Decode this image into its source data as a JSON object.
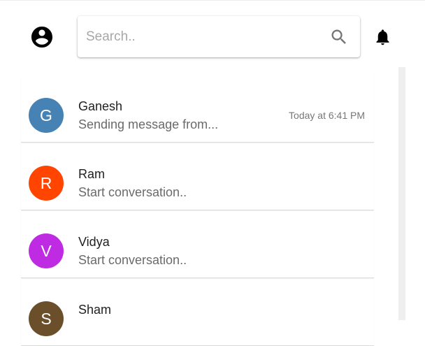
{
  "header": {
    "search_placeholder": "Search..",
    "search_value": ""
  },
  "icons": {
    "account": "account-circle-icon",
    "search": "search-icon",
    "notifications": "bell-icon"
  },
  "chats": [
    {
      "initial": "G",
      "name": "Ganesh",
      "preview": "Sending message from...",
      "time": "Today at 6:41 PM",
      "color": "#4682b4"
    },
    {
      "initial": "R",
      "name": "Ram",
      "preview": "Start conversation..",
      "time": "",
      "color": "#ff4500"
    },
    {
      "initial": "V",
      "name": "Vidya",
      "preview": "Start conversation..",
      "time": "",
      "color": "#bf2be2"
    },
    {
      "initial": "S",
      "name": "Sham",
      "preview": "",
      "time": "",
      "color": "#6b4f2a"
    }
  ],
  "colors": {
    "scroll_track": "#efefef",
    "placeholder": "#a7a7a7",
    "preview_text": "#6a6a6a"
  }
}
